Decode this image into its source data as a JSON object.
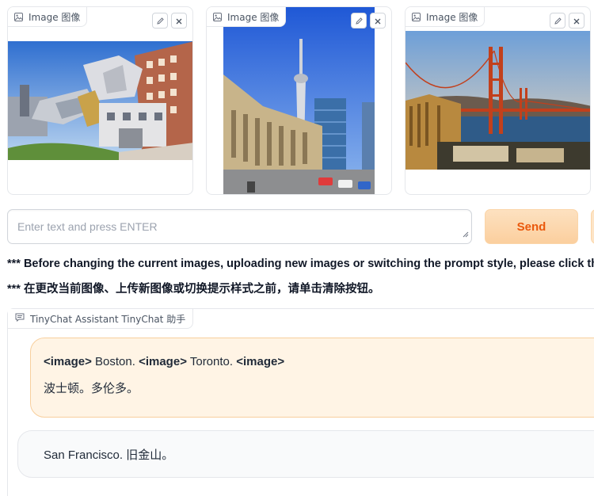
{
  "image_panels": [
    {
      "label": "Image 图像",
      "icon": "image-icon",
      "subject": "Boston"
    },
    {
      "label": "Image 图像",
      "icon": "image-icon",
      "subject": "Toronto"
    },
    {
      "label": "Image 图像",
      "icon": "image-icon",
      "subject": "San Francisco"
    }
  ],
  "input": {
    "placeholder": "Enter text and press ENTER",
    "value": ""
  },
  "buttons": {
    "send": "Send"
  },
  "notes": [
    "*** Before changing the current images, uploading new images or switching the prompt style, please click the",
    "*** 在更改当前图像、上传新图像或切换提示样式之前，请单击清除按钮。"
  ],
  "chatbot": {
    "label": "TinyChat Assistant TinyChat 助手",
    "user_message": {
      "segments": [
        {
          "tag": "<image>",
          "text": " Boston. "
        },
        {
          "tag": "<image>",
          "text": " Toronto. "
        },
        {
          "tag": "<image>",
          "text": ""
        }
      ],
      "line2": "波士顿。多伦多。"
    },
    "bot_message": "San Francisco. 旧金山。"
  },
  "colors": {
    "accent": "#ea580c",
    "send_bg": "#fdd8ae",
    "user_bubble": "#fff4e5",
    "bot_bubble": "#f9fafb"
  }
}
